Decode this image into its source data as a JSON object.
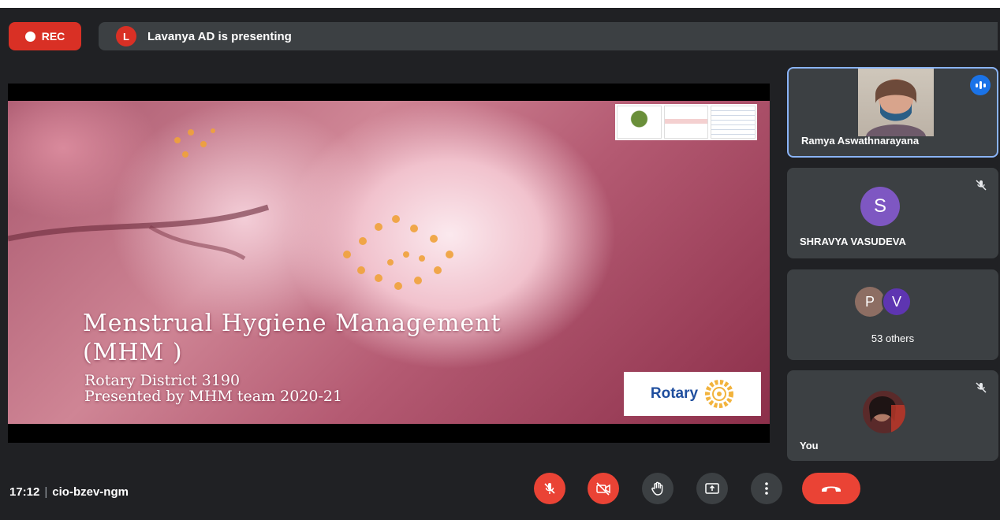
{
  "recording": {
    "label": "REC"
  },
  "presenting": {
    "avatar_letter": "L",
    "text": "Lavanya AD is presenting"
  },
  "slide": {
    "title_line1": "Menstrual Hygiene Management",
    "title_line2": "(MHM )",
    "subtitle_line1": "Rotary District 3190",
    "subtitle_line2": "Presented by MHM team 2020-21",
    "logo_text": "Rotary"
  },
  "participants": [
    {
      "name": "Ramya Aswathnarayana",
      "status": "speaking"
    },
    {
      "name": "SHRAVYA VASUDEVA",
      "avatar_letter": "S",
      "avatar_color": "#7e57c2",
      "status": "muted"
    },
    {
      "avatars": [
        {
          "letter": "P",
          "color": "#8d6e63"
        },
        {
          "letter": "V",
          "color": "#5e35b1"
        }
      ],
      "text": "53 others"
    },
    {
      "name": "You",
      "status": "muted"
    }
  ],
  "meeting": {
    "time": "17:12",
    "separator": "|",
    "code": "cio-bzev-ngm"
  },
  "controls": {
    "mic": "mic-off-icon",
    "camera": "camera-off-icon",
    "raise_hand": "hand-icon",
    "present": "present-screen-icon",
    "more": "more-vert-icon",
    "leave": "phone-hangup-icon"
  },
  "colors": {
    "background": "#202124",
    "tile": "#3c4043",
    "danger": "#ea4335",
    "accent": "#1a73e8",
    "speaking_border": "#8ab4f8"
  }
}
